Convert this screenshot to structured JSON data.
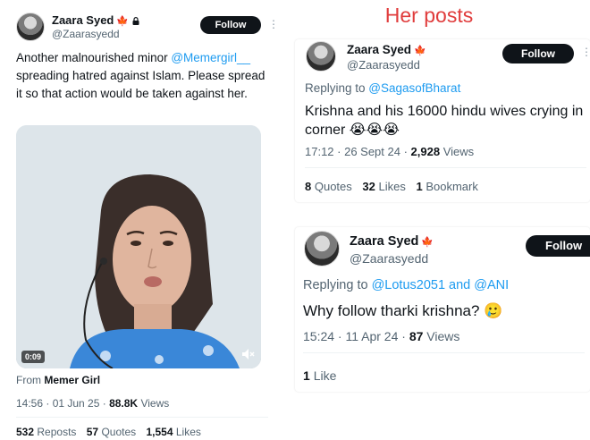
{
  "left_tweet": {
    "author_name": "Zaara Syed",
    "author_handle": "@Zaarasyedd",
    "follow_label": "Follow",
    "text_before": "Another malnourished minor ",
    "mention": "@Memergirl__",
    "text_after": " spreading hatred against Islam. Please spread it so that action would be taken against her.",
    "video_duration": "0:09",
    "from_prefix": "From",
    "from_source": "Memer Girl",
    "time": "14:56 · 01 Jun 25 · ",
    "views_count": "88.8K",
    "views_label": "Views",
    "reposts_count": "532",
    "reposts_label": "Reposts",
    "quotes_count": "57",
    "quotes_label": "Quotes",
    "likes_count": "1,554",
    "likes_label": "Likes"
  },
  "annotation": "Her posts",
  "post1": {
    "author_name": "Zaara Syed",
    "author_handle": "@Zaarasyedd",
    "follow_label": "Follow",
    "replying_prefix": "Replying to ",
    "replying_to": "@SagasofBharat",
    "text": "Krishna and his 16000 hindu wives crying in corner 😭😭😭",
    "time": "17:12 · 26 Sept 24 · ",
    "views_count": "2,928",
    "views_label": "Views",
    "quotes_count": "8",
    "quotes_label": "Quotes",
    "likes_count": "32",
    "likes_label": "Likes",
    "bookmarks_count": "1",
    "bookmarks_label": "Bookmark"
  },
  "post2": {
    "author_name": "Zaara Syed",
    "author_handle": "@Zaarasyedd",
    "follow_label": "Follow",
    "replying_prefix": "Replying to ",
    "replying_to": "@Lotus2051 and @ANI",
    "text": "Why follow tharki krishna? 🥲",
    "time": "15:24 · 11 Apr 24 · ",
    "views_count": "87",
    "views_label": "Views",
    "likes_count": "1",
    "likes_label": "Like"
  },
  "colors": {
    "accent": "#1d9bf0",
    "annotation": "#e03c3c",
    "button": "#0f1419",
    "flag": "#e8541e"
  }
}
